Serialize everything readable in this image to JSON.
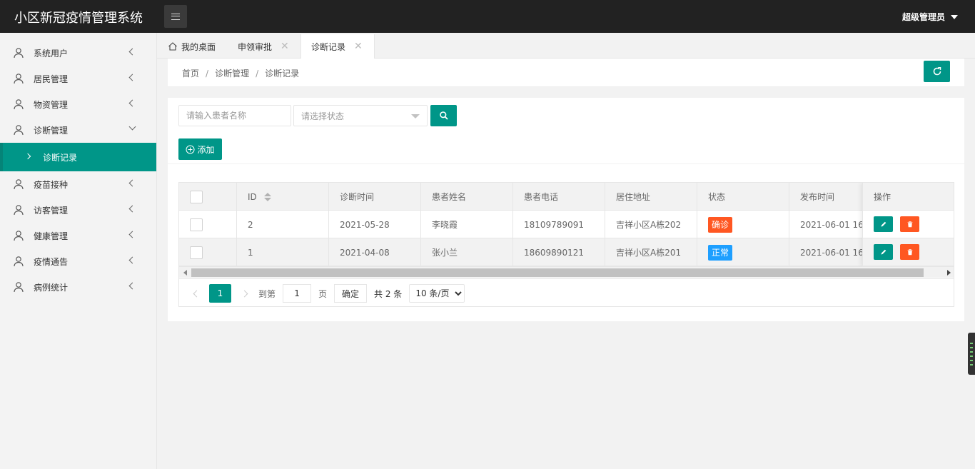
{
  "header": {
    "app_title": "小区新冠疫情管理系统",
    "user_label": "超级管理员"
  },
  "sidebar": {
    "items": [
      {
        "label": "系统用户"
      },
      {
        "label": "居民管理"
      },
      {
        "label": "物资管理"
      },
      {
        "label": "诊断管理"
      },
      {
        "label": "疫苗接种"
      },
      {
        "label": "访客管理"
      },
      {
        "label": "健康管理"
      },
      {
        "label": "疫情通告"
      },
      {
        "label": "病例统计"
      }
    ],
    "active_sub": "诊断记录"
  },
  "tabs": [
    {
      "label": "我的桌面"
    },
    {
      "label": "申领审批"
    },
    {
      "label": "诊断记录"
    }
  ],
  "breadcrumb": {
    "home": "首页",
    "sep": "/",
    "section": "诊断管理",
    "current": "诊断记录"
  },
  "toolbar": {
    "search_placeholder": "请输入患者名称",
    "status_placeholder": "请选择状态",
    "add_label": "添加"
  },
  "table": {
    "columns": [
      "ID",
      "诊断时间",
      "患者姓名",
      "患者电话",
      "居住地址",
      "状态",
      "发布时间",
      "操作"
    ],
    "rows": [
      {
        "id": "2",
        "diag_time": "2021-05-28",
        "name": "李晓霞",
        "phone": "18109789091",
        "address": "吉祥小区A栋202",
        "status": "确诊",
        "status_color": "#ff5722",
        "publish_time": "2021-06-01 16:..."
      },
      {
        "id": "1",
        "diag_time": "2021-04-08",
        "name": "张小兰",
        "phone": "18609890121",
        "address": "吉祥小区A栋201",
        "status": "正常",
        "status_color": "#1e9fff",
        "publish_time": "2021-06-01 16:..."
      }
    ]
  },
  "pagination": {
    "current": "1",
    "goto_label": "到第",
    "goto_value": "1",
    "page_label": "页",
    "confirm_label": "确定",
    "total_label": "共 2 条",
    "page_size": "10 条/页"
  },
  "colors": {
    "primary": "#009688",
    "danger": "#ff5722",
    "info": "#1e9fff",
    "header_bg": "#222222"
  }
}
